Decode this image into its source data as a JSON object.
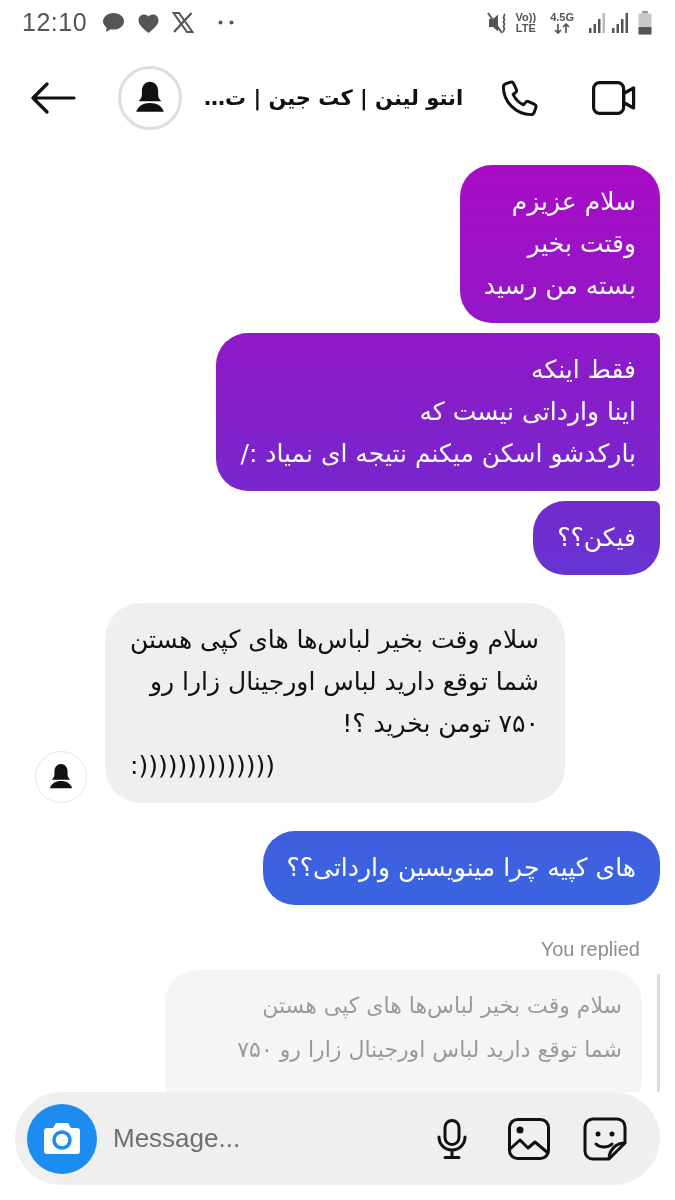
{
  "status_bar": {
    "time": "12:10",
    "volte_top": "Vo))",
    "volte_bottom": "LTE",
    "network": "4.5G"
  },
  "header": {
    "title": "انتو لینن | کت جین | ت…"
  },
  "messages": [
    {
      "kind": "sent",
      "lines": [
        "سلام عزیزم",
        "وقتت بخیر",
        "بسته من رسید"
      ]
    },
    {
      "kind": "sent",
      "lines": [
        "فقط اینکه",
        "اینا وارداتی نیست که",
        "بارکدشو اسکن میکنم نتیجه ای نمیاد :/"
      ]
    },
    {
      "kind": "sent",
      "lines": [
        "فیکن؟؟"
      ]
    },
    {
      "kind": "received",
      "lines": [
        "سلام وقت بخیر لباس‌ها های کپی هستن",
        "شما توقع دارید لباس اورجینال زارا رو",
        "۷۵۰ تومن بخرید ؟!",
        ":))))))))))))))"
      ]
    },
    {
      "kind": "sent",
      "lines": [
        "های کپیه چرا مینویسین وارداتی؟؟"
      ]
    }
  ],
  "reply_preview": {
    "label": "You replied",
    "lines": [
      "سلام وقت بخیر لباس‌ها های کپی هستن",
      "شما توقع دارید لباس اورجینال زارا رو ۷۵۰"
    ]
  },
  "composer": {
    "placeholder": "Message..."
  }
}
